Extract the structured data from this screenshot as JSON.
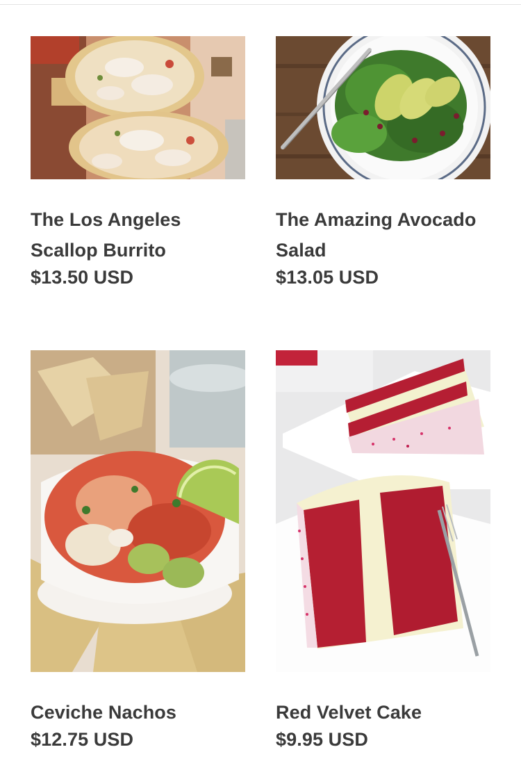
{
  "products": [
    {
      "title": "The Los Angeles Scallop Burrito",
      "price": "$13.50 USD",
      "image": "scallop-burrito-photo"
    },
    {
      "title": "The Amazing Avocado Salad",
      "price": "$13.05 USD",
      "image": "avocado-salad-photo"
    },
    {
      "title": "Ceviche Nachos",
      "price": "$12.75 USD",
      "image": "ceviche-nachos-photo"
    },
    {
      "title": "Red Velvet Cake",
      "price": "$9.95 USD",
      "image": "red-velvet-cake-photo"
    }
  ],
  "colors": {
    "text": "#3a3a3a",
    "divider": "#e4e4e4"
  }
}
